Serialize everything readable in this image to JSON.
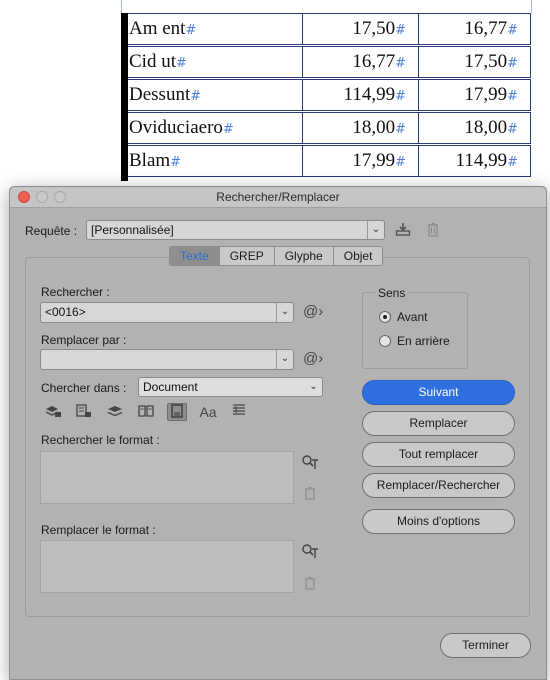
{
  "document_table": {
    "rows": [
      {
        "label": "Am ent",
        "col2": "17,50",
        "col3": "16,77"
      },
      {
        "label": "Cid ut",
        "col2": "16,77",
        "col3": "17,50"
      },
      {
        "label": "Dessunt",
        "col2": "114,99",
        "col3": "17,99"
      },
      {
        "label": "Oviduciaero",
        "col2": "18,00",
        "col3": "18,00"
      },
      {
        "label": "Blam",
        "col2": "17,99",
        "col3": "114,99"
      }
    ],
    "mark": "#"
  },
  "dialog": {
    "title": "Rechercher/Remplacer",
    "query_label": "Requête :",
    "query_value": "[Personnalisée]",
    "tabs": [
      "Texte",
      "GREP",
      "Glyphe",
      "Objet"
    ],
    "active_tab": "Texte",
    "find_label": "Rechercher :",
    "find_value": "<0016>",
    "replace_label": "Remplacer par :",
    "replace_value": "",
    "search_in_label": "Chercher dans :",
    "search_in_value": "Document",
    "find_format_label": "Rechercher le format :",
    "replace_format_label": "Remplacer le format :",
    "direction": {
      "title": "Sens",
      "forward": "Avant",
      "backward": "En arrière",
      "selected": "Avant"
    },
    "buttons": {
      "next": "Suivant",
      "replace": "Remplacer",
      "replace_all": "Tout remplacer",
      "replace_find": "Remplacer/Rechercher",
      "fewer_options": "Moins d'options",
      "done": "Terminer"
    },
    "tools": {
      "case_label": "Aa"
    },
    "colors": {
      "accent": "#2f6fe0",
      "tab_active_text": "#2c6fd4",
      "dialog_bg": "#b2b2b2",
      "close_button": "#ee5e57"
    }
  }
}
